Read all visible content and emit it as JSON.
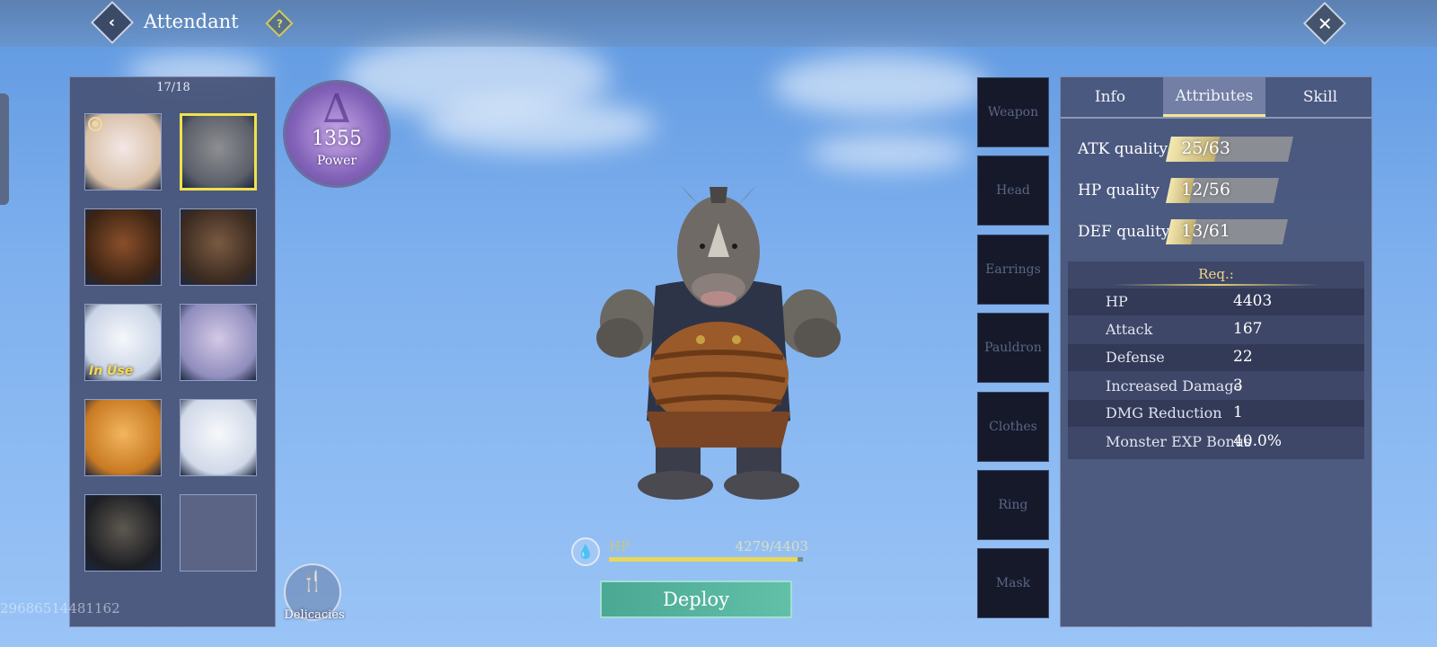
{
  "header": {
    "title": "Attendant",
    "back_glyph": "‹",
    "help_glyph": "?",
    "close_glyph": "✕"
  },
  "attendants": {
    "count": "17/18",
    "slots": [
      {
        "name": "white-haired-woman",
        "locked": true,
        "in_use": false,
        "selected": false,
        "palette": [
          "#d8c0a6",
          "#f3e7e6"
        ]
      },
      {
        "name": "rhino",
        "locked": false,
        "in_use": false,
        "selected": true,
        "palette": [
          "#5b5f69",
          "#8d8e92"
        ]
      },
      {
        "name": "bear",
        "locked": false,
        "in_use": false,
        "selected": false,
        "palette": [
          "#3c2414",
          "#8a4f2a"
        ]
      },
      {
        "name": "squid-face",
        "locked": false,
        "in_use": false,
        "selected": false,
        "palette": [
          "#3a2a20",
          "#7a5a42"
        ]
      },
      {
        "name": "white-fox",
        "locked": false,
        "in_use": true,
        "selected": false,
        "palette": [
          "#c9d4e6",
          "#f5f7fb"
        ]
      },
      {
        "name": "elf-elder",
        "locked": false,
        "in_use": false,
        "selected": false,
        "palette": [
          "#8f8dbd",
          "#d3c8e6"
        ]
      },
      {
        "name": "orange-haired-girl",
        "locked": false,
        "in_use": false,
        "selected": false,
        "palette": [
          "#c87a22",
          "#f2b55e"
        ]
      },
      {
        "name": "white-fox-2",
        "locked": false,
        "in_use": false,
        "selected": false,
        "palette": [
          "#d0d9e8",
          "#f7f8fb"
        ]
      },
      {
        "name": "eagle",
        "locked": false,
        "in_use": false,
        "selected": false,
        "palette": [
          "#1d1f24",
          "#5e5850"
        ]
      },
      {
        "name": "empty",
        "locked": false,
        "in_use": false,
        "selected": false,
        "palette": []
      }
    ],
    "in_use_label": "In Use",
    "lock_glyph": "🔓"
  },
  "power": {
    "value": "1355",
    "label": "Power",
    "glyph": "∆"
  },
  "hp": {
    "label": "HP",
    "value": "4279/4403",
    "fraction": 0.972,
    "icon": "drop-icon"
  },
  "deploy_label": "Deploy",
  "delicacies": {
    "label": "Delicacies",
    "icon": "🍴"
  },
  "uid": "2968651448116​2",
  "equipment": [
    "Weapon",
    "Head",
    "Earrings",
    "Pauldron",
    "Clothes",
    "Ring",
    "Mask"
  ],
  "tabs": [
    {
      "label": "Info",
      "active": false
    },
    {
      "label": "Attributes",
      "active": true
    },
    {
      "label": "Skill",
      "active": false
    }
  ],
  "qualities": [
    {
      "label": "ATK quality",
      "value": "25/63",
      "fraction": 0.397
    },
    {
      "label": "HP quality",
      "value": "12/56",
      "fraction": 0.214
    },
    {
      "label": "DEF quality",
      "value": "13/61",
      "fraction": 0.213
    }
  ],
  "requirements": {
    "title": "Req.:",
    "rows": [
      {
        "name": "HP",
        "value": "4403"
      },
      {
        "name": "Attack",
        "value": "167"
      },
      {
        "name": "Defense",
        "value": "22"
      },
      {
        "name": "Increased Damage",
        "value": "3"
      },
      {
        "name": "DMG Reduction",
        "value": "1"
      },
      {
        "name": "Monster EXP Bonus",
        "value": "40.0%"
      }
    ]
  },
  "colors": {
    "accent_gold": "#f0e24b",
    "deploy_teal": "#4aa893",
    "panel": "#48526f"
  }
}
